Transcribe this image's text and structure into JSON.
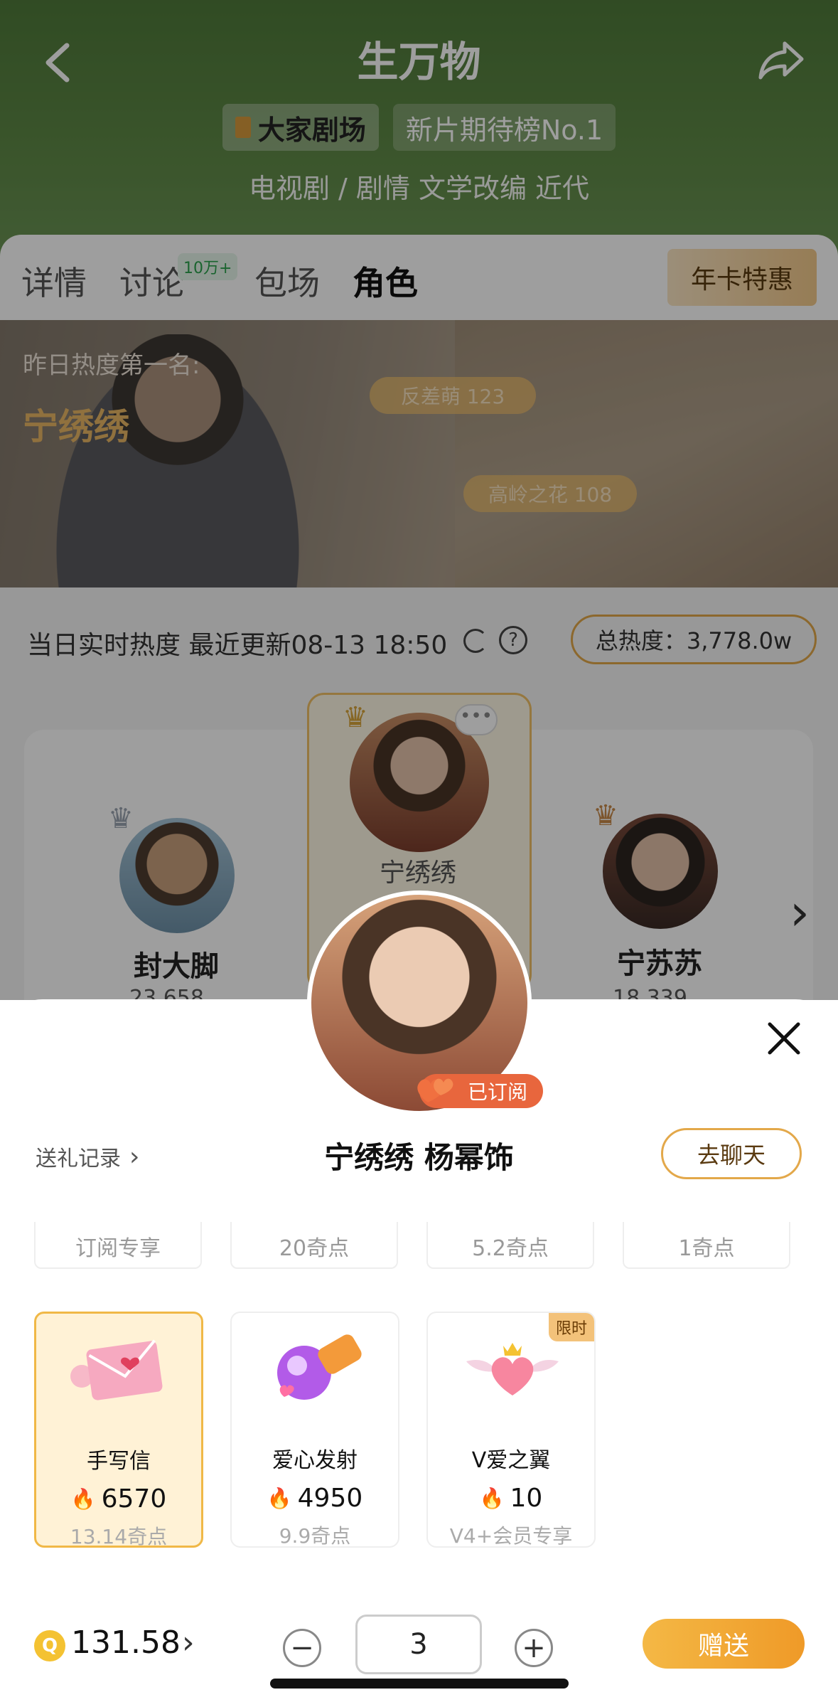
{
  "header": {
    "title": "生万物",
    "brand_chip": "大家剧场",
    "rank_chip": "新片期待榜No.1",
    "genre": "电视剧 / 剧情 文学改编 近代"
  },
  "tabs": [
    {
      "label": "详情"
    },
    {
      "label": "讨论",
      "badge": "10万+"
    },
    {
      "label": "包场"
    },
    {
      "label": "角色",
      "active": true
    }
  ],
  "promo": "年卡特惠",
  "hero": {
    "label": "昨日热度第一名:",
    "name": "宁绣绣",
    "tags": [
      "反差萌 123",
      "高岭之花 108"
    ]
  },
  "stats": {
    "realtime": "当日实时热度 最近更新08-13 18:50",
    "total": "总热度：3,778.0w"
  },
  "ranking": [
    {
      "name": "封大脚",
      "score": "23,658",
      "rank": 2
    },
    {
      "name": "宁绣绣",
      "rank": 1
    },
    {
      "name": "宁苏苏",
      "score": "18,339",
      "rank": 3
    }
  ],
  "sheet": {
    "subscribed": "已订阅",
    "gift_log": "送礼记录",
    "character_title": "宁绣绣 杨幂饰",
    "chat_button": "去聊天",
    "partial_row": [
      "订阅专享",
      "20奇点",
      "5.2奇点",
      "1奇点"
    ],
    "gifts": [
      {
        "name": "手写信",
        "heat": "6570",
        "price": "13.14奇点",
        "selected": true
      },
      {
        "name": "爱心发射",
        "heat": "4950",
        "price": "9.9奇点"
      },
      {
        "name": "V爱之翼",
        "heat": "10",
        "price": "V4+会员专享",
        "badge": "限时"
      }
    ]
  },
  "bottom": {
    "coin_icon": "Q",
    "balance": "131.58",
    "quantity": "3",
    "send_button": "赠送"
  },
  "colors": {
    "header_green": "#5f8a47",
    "accent_orange": "#f0a83a",
    "gold_border": "#e3a84a"
  }
}
